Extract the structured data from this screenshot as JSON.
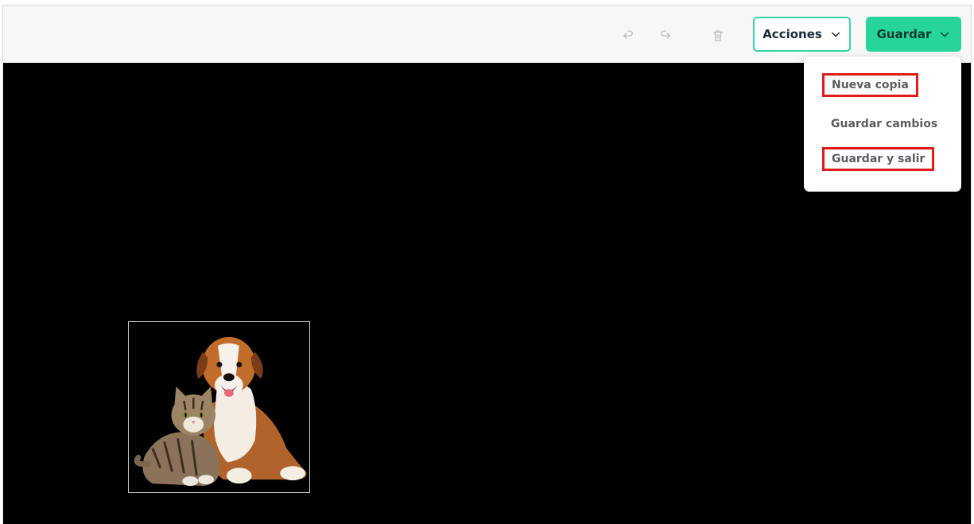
{
  "toolbar": {
    "undo_icon": "undo-icon",
    "redo_icon": "redo-icon",
    "delete_icon": "trash-icon",
    "acciones_label": "Acciones",
    "guardar_label": "Guardar"
  },
  "dropdown": {
    "items": [
      {
        "label": "Nueva copia",
        "highlighted": true
      },
      {
        "label": "Guardar cambios",
        "highlighted": false
      },
      {
        "label": "Guardar y salir",
        "highlighted": true
      }
    ]
  },
  "colors": {
    "accent": "#27d59c",
    "accent_border": "#35d3a4",
    "highlight_border": "#e01b1b",
    "canvas_bg": "#000000"
  }
}
